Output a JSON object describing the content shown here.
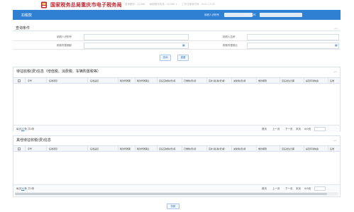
{
  "header": {
    "site_title": "国家税务总局重庆市电子税务局",
    "info_items": [
      "咨询服务 : 12366",
      "纳税服务热线 : 12366-1",
      "工作日服务时间 : 9:00-17:00"
    ]
  },
  "navbar": {
    "tab_label": "扣税款",
    "taxpayer_id_label": "纳税人识别号",
    "taxpayer_name_label": "纳税人名称"
  },
  "query": {
    "title": "查询条件",
    "fields": [
      {
        "label": "纳税人识别号",
        "value": ""
      },
      {
        "label": "纳税人名称",
        "value": ""
      },
      {
        "label": "税款所属期起",
        "value": ""
      },
      {
        "label": "税款所属期止",
        "value": ""
      }
    ],
    "search_button": "查询",
    "reset_button": "重置"
  },
  "grid1": {
    "title": "待征收税(费)信息（增值税、消费税、车辆购置税等）",
    "columns": [
      "序号",
      "征收项目",
      "征收品目",
      "税款所属期",
      "税款所属期止",
      "应征应纳税(费)额",
      "已缴税(费)额",
      "应补(退)税(费)额",
      "减免税(费)额",
      "缴款期限",
      "应征发生日期",
      "是否有滞纳金",
      "征收"
    ],
    "pager": {
      "page_size_label": "每页",
      "page_size": "20",
      "page_size_suffix": "条",
      "total": "共0条",
      "first": "首页",
      "prev": "上一页",
      "next": "下一页",
      "last": "末页",
      "page_info": "0/0页"
    }
  },
  "grid2": {
    "title": "其他待征收税(费)信息",
    "columns": [
      "序号",
      "征收项目",
      "征收品目",
      "税款所属期",
      "税款所属期止",
      "应征应纳税(费)额",
      "已缴税(费)额",
      "应补(退)税(费)额",
      "减免税(费)额",
      "缴款期限",
      "应征发生日期",
      "是否有滞纳金",
      "征收"
    ],
    "pager": {
      "page_size_label": "每页",
      "page_size": "20",
      "page_size_suffix": "条",
      "total": "共0条",
      "first": "首页",
      "prev": "上一页",
      "next": "下一页",
      "last": "末页",
      "page_info": "0/0页"
    }
  },
  "footer": {
    "submit_button": "扣款"
  },
  "colors": {
    "brand_blue": "#2f7fd2",
    "title_red": "#c0262e"
  }
}
